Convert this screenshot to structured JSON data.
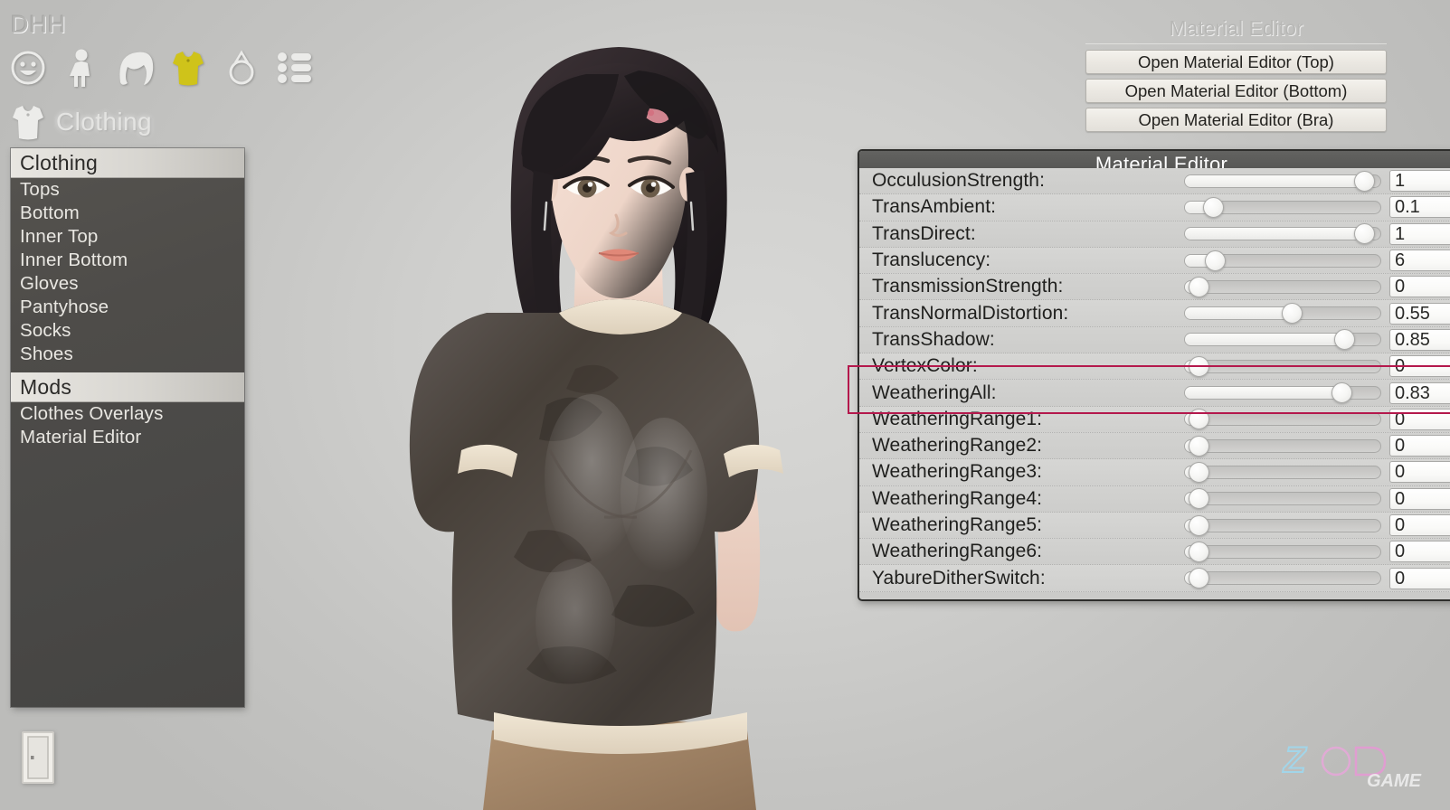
{
  "hud": {
    "app_title": "DHH",
    "category_label": "Clothing",
    "toolbar_icons": [
      {
        "name": "face-icon",
        "label": "Face"
      },
      {
        "name": "body-icon",
        "label": "Body"
      },
      {
        "name": "hair-icon",
        "label": "Hair"
      },
      {
        "name": "clothing-icon",
        "label": "Clothing",
        "selected": true,
        "color": "#cfc31a"
      },
      {
        "name": "accessory-ring-icon",
        "label": "Accessories"
      },
      {
        "name": "list-icon",
        "label": "List"
      }
    ],
    "exit_label": "Exit"
  },
  "menu": {
    "sections": [
      {
        "header": "Clothing",
        "items": [
          "Tops",
          "Bottom",
          "Inner Top",
          "Inner Bottom",
          "Gloves",
          "Pantyhose",
          "Socks",
          "Shoes"
        ]
      },
      {
        "header": "Mods",
        "items": [
          "Clothes Overlays",
          "Material Editor"
        ]
      }
    ]
  },
  "material_editor_launcher": {
    "title": "Material Editor",
    "buttons": [
      "Open Material Editor (Top)",
      "Open Material Editor (Bottom)",
      "Open Material Editor (Bra)"
    ]
  },
  "material_editor": {
    "title": "Material Editor",
    "highlighted_property": "WeatheringAll",
    "highlight_color": "#b4184c",
    "rows": [
      {
        "label": "OcculusionStrength:",
        "value": "1",
        "fill": 96,
        "clipped_top": true
      },
      {
        "label": "TransAmbient:",
        "value": "0.1",
        "fill": 10
      },
      {
        "label": "TransDirect:",
        "value": "1",
        "fill": 96
      },
      {
        "label": "Translucency:",
        "value": "6",
        "fill": 11
      },
      {
        "label": "TransmissionStrength:",
        "value": "0",
        "fill": 2
      },
      {
        "label": "TransNormalDistortion:",
        "value": "0.55",
        "fill": 55
      },
      {
        "label": "TransShadow:",
        "value": "0.85",
        "fill": 85
      },
      {
        "label": "VertexColor:",
        "value": "0",
        "fill": 2
      },
      {
        "label": "WeatheringAll:",
        "value": "0.83",
        "fill": 83,
        "highlighted": true
      },
      {
        "label": "WeatheringRange1:",
        "value": "0",
        "fill": 2
      },
      {
        "label": "WeatheringRange2:",
        "value": "0",
        "fill": 2
      },
      {
        "label": "WeatheringRange3:",
        "value": "0",
        "fill": 2
      },
      {
        "label": "WeatheringRange4:",
        "value": "0",
        "fill": 2
      },
      {
        "label": "WeatheringRange5:",
        "value": "0",
        "fill": 2
      },
      {
        "label": "WeatheringRange6:",
        "value": "0",
        "fill": 2
      },
      {
        "label": "YabureDitherSwitch:",
        "value": "0",
        "fill": 2
      }
    ]
  },
  "watermark": {
    "primary": "ZOD",
    "secondary": "GAME"
  }
}
